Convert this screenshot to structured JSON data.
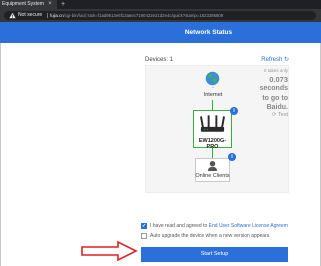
{
  "browser": {
    "tab_title": "Equipment System",
    "tab_close": "×",
    "new_tab": "+",
    "security_label": "Not secure",
    "url_host": "fujia.cn",
    "url_rest": "/cgi-bin/luci/;stok=f1ad9513e6f13a6ec7190422e21d2e4c/quick?stamp=1623386809",
    "security_icon": "warning-triangle-icon"
  },
  "header": {
    "title": "Network Status",
    "color": "#2b6fdb"
  },
  "devices": {
    "label": "Devices: 1",
    "refresh_label": "Refresh ↻"
  },
  "topology": {
    "internet_status": "-",
    "internet_label": "Internet",
    "router_label": "EW1200G-PRO",
    "router_badge": "i",
    "clients_label": "Online Clients",
    "clients_badge": "i",
    "link_color": "#31b33f"
  },
  "speed": {
    "note": "It takes only",
    "value": "0.073",
    "unit": "seconds",
    "destination_line1": "to go to",
    "destination_line2": "Baidu.",
    "test_label": "⟳ Test"
  },
  "options": {
    "agree_prefix": "I have read and agreed to ",
    "agree_link": "End User Software License Agreem",
    "agree_checked": true,
    "auto_upgrade_label": "Auto upgrade the device when a new version appears.",
    "auto_upgrade_checked": false
  },
  "actions": {
    "start_setup": "Start Setup"
  },
  "annotation": {
    "arrow_color": "#e02020"
  }
}
